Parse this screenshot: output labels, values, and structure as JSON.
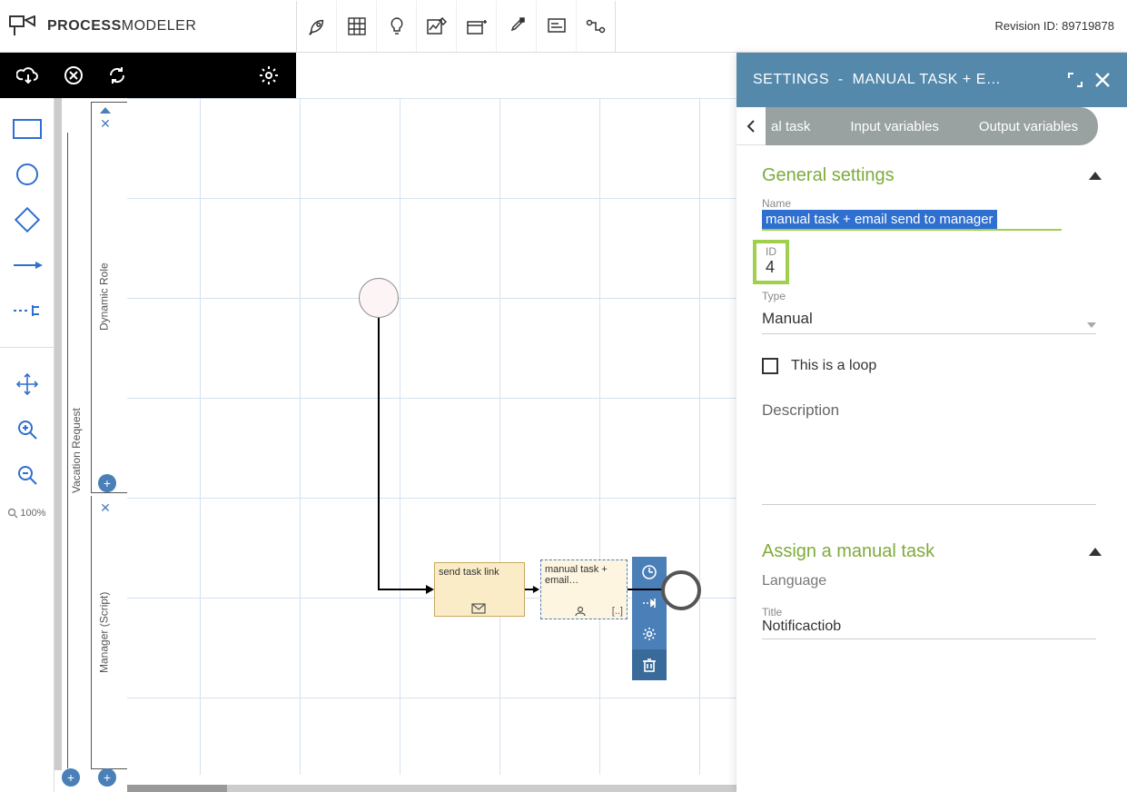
{
  "header": {
    "logo_a": "PROCESS",
    "logo_b": "MODELER",
    "revision_label": "Revision ID: ",
    "revision_id": "89719878"
  },
  "zoom_level": "100%",
  "pool": {
    "name": "Vacation Request",
    "lanes": [
      {
        "name": "Dynamic Role"
      },
      {
        "name": "Manager (Script)"
      }
    ]
  },
  "nodes": {
    "task1": {
      "label": "send task link"
    },
    "task2": {
      "label": "manual task + email…",
      "corner": "[..]"
    }
  },
  "settings": {
    "title_a": "SETTINGS",
    "title_sep": "-",
    "title_b": "MANUAL TASK + E…",
    "tabs": {
      "partial": "al task",
      "t2": "Input variables",
      "t3": "Output variables"
    },
    "general": {
      "header": "General settings",
      "name_label": "Name",
      "name_value": "manual task + email send to manager",
      "id_label": "ID",
      "id_value": "4",
      "type_label": "Type",
      "type_value": "Manual",
      "loop_label": "This is a loop",
      "desc_label": "Description"
    },
    "assign": {
      "header": "Assign a manual task",
      "language_label": "Language",
      "title_label": "Title",
      "title_value": "Notificactiob"
    }
  }
}
